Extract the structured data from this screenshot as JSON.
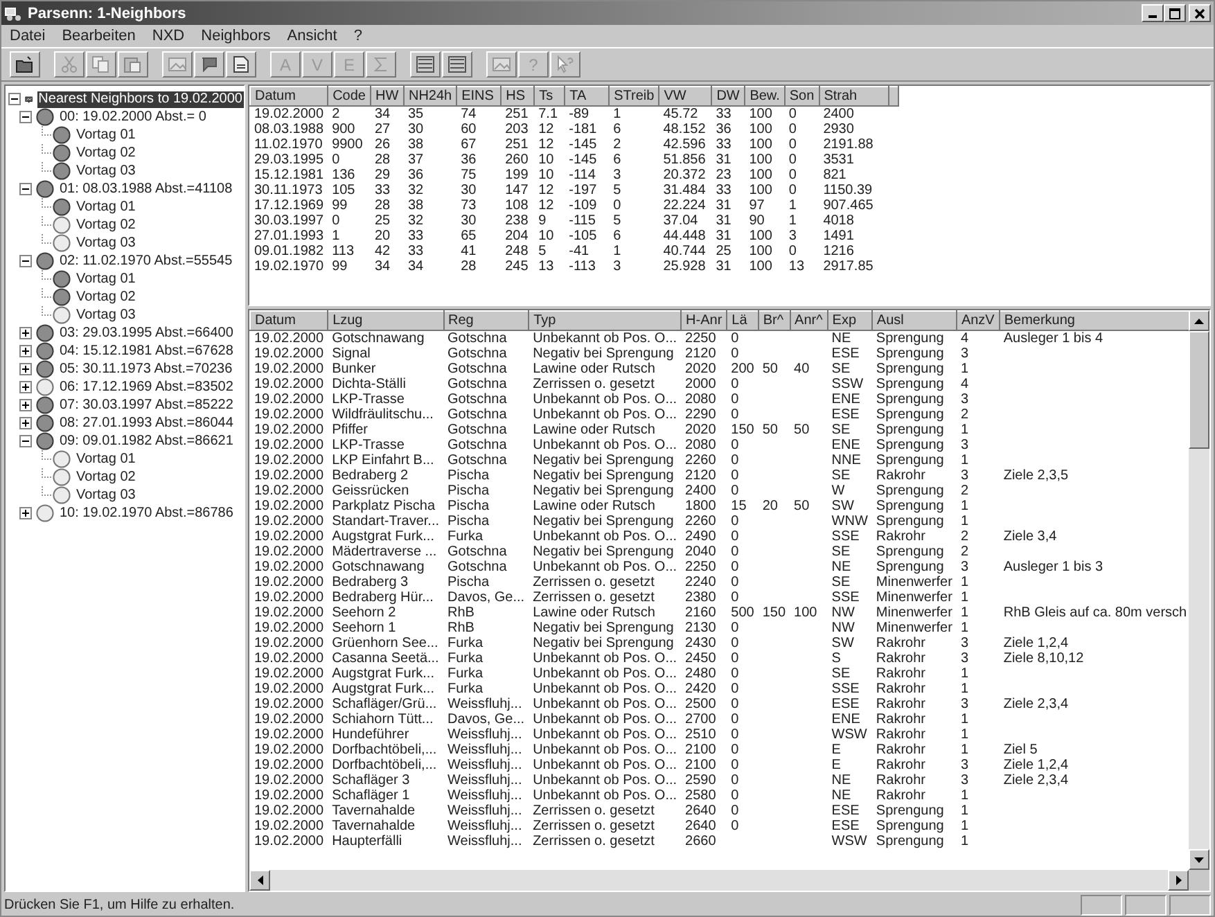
{
  "window": {
    "title": "Parsenn: 1-Neighbors"
  },
  "menu": [
    "Datei",
    "Bearbeiten",
    "NXD",
    "Neighbors",
    "Ansicht",
    "?"
  ],
  "toolbar": [
    {
      "kind": "folder"
    },
    {
      "kind": "sep"
    },
    {
      "kind": "cut"
    },
    {
      "kind": "copy"
    },
    {
      "kind": "paste"
    },
    {
      "kind": "sep"
    },
    {
      "kind": "image"
    },
    {
      "kind": "flag"
    },
    {
      "kind": "page"
    },
    {
      "kind": "sep"
    },
    {
      "kind": "letter",
      "label": "A"
    },
    {
      "kind": "letter",
      "label": "V"
    },
    {
      "kind": "letter",
      "label": "E"
    },
    {
      "kind": "sigma"
    },
    {
      "kind": "sep"
    },
    {
      "kind": "list"
    },
    {
      "kind": "list"
    },
    {
      "kind": "sep"
    },
    {
      "kind": "image"
    },
    {
      "kind": "letter",
      "label": "?"
    },
    {
      "kind": "helpcursor"
    }
  ],
  "tree": {
    "label": "Nearest Neighbors to 19.02.2000",
    "selected": true,
    "expanded": true,
    "children": [
      {
        "label": "00: 19.02.2000 Abst.=  0",
        "filled": true,
        "expanded": true,
        "children": [
          {
            "label": "Vortag 01",
            "filled": true
          },
          {
            "label": "Vortag 02",
            "filled": true
          },
          {
            "label": "Vortag 03",
            "filled": true
          }
        ]
      },
      {
        "label": "01: 08.03.1988 Abst.=41108",
        "filled": true,
        "expanded": true,
        "children": [
          {
            "label": "Vortag 01",
            "filled": true
          },
          {
            "label": "Vortag 02",
            "filled": false
          },
          {
            "label": "Vortag 03",
            "filled": false
          }
        ]
      },
      {
        "label": "02: 11.02.1970 Abst.=55545",
        "filled": true,
        "expanded": true,
        "children": [
          {
            "label": "Vortag 01",
            "filled": true
          },
          {
            "label": "Vortag 02",
            "filled": true
          },
          {
            "label": "Vortag 03",
            "filled": false
          }
        ]
      },
      {
        "label": "03: 29.03.1995 Abst.=66400",
        "filled": true,
        "expanded": false
      },
      {
        "label": "04: 15.12.1981 Abst.=67628",
        "filled": true,
        "expanded": false
      },
      {
        "label": "05: 30.11.1973 Abst.=70236",
        "filled": true,
        "expanded": false
      },
      {
        "label": "06: 17.12.1969 Abst.=83502",
        "filled": false,
        "expanded": false
      },
      {
        "label": "07: 30.03.1997 Abst.=85222",
        "filled": true,
        "expanded": false
      },
      {
        "label": "08: 27.01.1993 Abst.=86044",
        "filled": true,
        "expanded": false
      },
      {
        "label": "09: 09.01.1982 Abst.=86621",
        "filled": true,
        "expanded": true,
        "children": [
          {
            "label": "Vortag 01",
            "filled": false
          },
          {
            "label": "Vortag 02",
            "filled": false
          },
          {
            "label": "Vortag 03",
            "filled": false
          }
        ]
      },
      {
        "label": "10: 19.02.1970 Abst.=86786",
        "filled": false,
        "expanded": false
      }
    ]
  },
  "neighbors_table": {
    "columns": [
      "Datum",
      "Code",
      "HW",
      "NH24h",
      "EINS",
      "HS",
      "Ts",
      "TA",
      "STreib",
      "VW",
      "DW",
      "Bew.",
      "Son",
      "Strah"
    ],
    "rows": [
      [
        "19.02.2000",
        "2",
        "34",
        "35",
        "74",
        "251",
        "7.1",
        "-89",
        "1",
        "45.72",
        "33",
        "100",
        "0",
        "2400"
      ],
      [
        "08.03.1988",
        "900",
        "27",
        "30",
        "60",
        "203",
        "12",
        "-181",
        "6",
        "48.152",
        "36",
        "100",
        "0",
        "2930"
      ],
      [
        "11.02.1970",
        "9900",
        "26",
        "38",
        "67",
        "251",
        "12",
        "-145",
        "2",
        "42.596",
        "33",
        "100",
        "0",
        "2191.88"
      ],
      [
        "29.03.1995",
        "0",
        "28",
        "37",
        "36",
        "260",
        "10",
        "-145",
        "6",
        "51.856",
        "31",
        "100",
        "0",
        "3531"
      ],
      [
        "15.12.1981",
        "136",
        "29",
        "36",
        "75",
        "199",
        "10",
        "-114",
        "3",
        "20.372",
        "23",
        "100",
        "0",
        "821"
      ],
      [
        "30.11.1973",
        "105",
        "33",
        "32",
        "30",
        "147",
        "12",
        "-197",
        "5",
        "31.484",
        "33",
        "100",
        "0",
        "1150.39"
      ],
      [
        "17.12.1969",
        "99",
        "28",
        "38",
        "73",
        "108",
        "12",
        "-109",
        "0",
        "22.224",
        "31",
        "97",
        "1",
        "907.465"
      ],
      [
        "30.03.1997",
        "0",
        "25",
        "32",
        "30",
        "238",
        "9",
        "-115",
        "5",
        "37.04",
        "31",
        "90",
        "1",
        "4018"
      ],
      [
        "27.01.1993",
        "1",
        "20",
        "33",
        "65",
        "204",
        "10",
        "-105",
        "6",
        "44.448",
        "31",
        "100",
        "3",
        "1491"
      ],
      [
        "09.01.1982",
        "113",
        "42",
        "33",
        "41",
        "248",
        "5",
        "-41",
        "1",
        "40.744",
        "25",
        "100",
        "0",
        "1216"
      ],
      [
        "19.02.1970",
        "99",
        "34",
        "34",
        "28",
        "245",
        "13",
        "-113",
        "3",
        "25.928",
        "31",
        "100",
        "13",
        "2917.85"
      ]
    ]
  },
  "events_table": {
    "columns": [
      "Datum",
      "Lzug",
      "Reg",
      "Typ",
      "H-Anr",
      "Lä",
      "Br^",
      "Anr^",
      "Exp",
      "Ausl",
      "AnzV",
      "Bemerkung"
    ],
    "rows": [
      [
        "19.02.2000",
        "Gotschnawang",
        "Gotschna",
        "Unbekannt ob Pos. O...",
        "2250",
        "0",
        "",
        "",
        "NE",
        "Sprengung",
        "4",
        "Ausleger 1 bis 4"
      ],
      [
        "19.02.2000",
        "Signal",
        "Gotschna",
        "Negativ bei Sprengung",
        "2120",
        "0",
        "",
        "",
        "ESE",
        "Sprengung",
        "3",
        ""
      ],
      [
        "19.02.2000",
        "Bunker",
        "Gotschna",
        "Lawine oder Rutsch",
        "2020",
        "200",
        "50",
        "40",
        "SE",
        "Sprengung",
        "1",
        ""
      ],
      [
        "19.02.2000",
        "Dichta-Ställi",
        "Gotschna",
        "Zerrissen o. gesetzt",
        "2000",
        "0",
        "",
        "",
        "SSW",
        "Sprengung",
        "4",
        ""
      ],
      [
        "19.02.2000",
        "LKP-Trasse",
        "Gotschna",
        "Unbekannt ob Pos. O...",
        "2080",
        "0",
        "",
        "",
        "ENE",
        "Sprengung",
        "3",
        ""
      ],
      [
        "19.02.2000",
        "Wildfräulitschu...",
        "Gotschna",
        "Unbekannt ob Pos. O...",
        "2290",
        "0",
        "",
        "",
        "ESE",
        "Sprengung",
        "2",
        ""
      ],
      [
        "19.02.2000",
        "Pfiffer",
        "Gotschna",
        "Lawine oder Rutsch",
        "2020",
        "150",
        "50",
        "50",
        "SE",
        "Sprengung",
        "1",
        ""
      ],
      [
        "19.02.2000",
        "LKP-Trasse",
        "Gotschna",
        "Unbekannt ob Pos. O...",
        "2080",
        "0",
        "",
        "",
        "ENE",
        "Sprengung",
        "3",
        ""
      ],
      [
        "19.02.2000",
        "LKP Einfahrt B...",
        "Gotschna",
        "Negativ bei Sprengung",
        "2260",
        "0",
        "",
        "",
        "NNE",
        "Sprengung",
        "1",
        ""
      ],
      [
        "19.02.2000",
        "Bedraberg 2",
        "Pischa",
        "Negativ bei Sprengung",
        "2120",
        "0",
        "",
        "",
        "SE",
        "Rakrohr",
        "3",
        "Ziele 2,3,5"
      ],
      [
        "19.02.2000",
        "Geissrücken",
        "Pischa",
        "Negativ bei Sprengung",
        "2400",
        "0",
        "",
        "",
        "W",
        "Sprengung",
        "2",
        ""
      ],
      [
        "19.02.2000",
        "Parkplatz Pischa",
        "Pischa",
        "Lawine oder Rutsch",
        "1800",
        "15",
        "20",
        "50",
        "SW",
        "Sprengung",
        "1",
        ""
      ],
      [
        "19.02.2000",
        "Standart-Traver...",
        "Pischa",
        "Negativ bei Sprengung",
        "2260",
        "0",
        "",
        "",
        "WNW",
        "Sprengung",
        "1",
        ""
      ],
      [
        "19.02.2000",
        "Augstgrat Furk...",
        "Furka",
        "Unbekannt ob Pos. O...",
        "2490",
        "0",
        "",
        "",
        "SSE",
        "Rakrohr",
        "2",
        "Ziele 3,4"
      ],
      [
        "19.02.2000",
        "Mädertraverse ...",
        "Gotschna",
        "Negativ bei Sprengung",
        "2040",
        "0",
        "",
        "",
        "SE",
        "Sprengung",
        "2",
        ""
      ],
      [
        "19.02.2000",
        "Gotschnawang",
        "Gotschna",
        "Unbekannt ob Pos. O...",
        "2250",
        "0",
        "",
        "",
        "NE",
        "Sprengung",
        "3",
        "Ausleger 1 bis 3"
      ],
      [
        "19.02.2000",
        "Bedraberg 3",
        "Pischa",
        "Zerrissen o. gesetzt",
        "2240",
        "0",
        "",
        "",
        "SE",
        "Minenwerfer",
        "1",
        ""
      ],
      [
        "19.02.2000",
        "Bedraberg Hür...",
        "Davos, Ge...",
        "Zerrissen o. gesetzt",
        "2380",
        "0",
        "",
        "",
        "SSE",
        "Minenwerfer",
        "1",
        ""
      ],
      [
        "19.02.2000",
        "Seehorn 2",
        "RhB",
        "Lawine oder Rutsch",
        "2160",
        "500",
        "150",
        "100",
        "NW",
        "Minenwerfer",
        "1",
        "RhB Gleis auf ca. 80m versch"
      ],
      [
        "19.02.2000",
        "Seehorn 1",
        "RhB",
        "Negativ bei Sprengung",
        "2130",
        "0",
        "",
        "",
        "NW",
        "Minenwerfer",
        "1",
        ""
      ],
      [
        "19.02.2000",
        "Grüenhorn See...",
        "Furka",
        "Negativ bei Sprengung",
        "2430",
        "0",
        "",
        "",
        "SW",
        "Rakrohr",
        "3",
        "Ziele 1,2,4"
      ],
      [
        "19.02.2000",
        "Casanna Seetä...",
        "Furka",
        "Unbekannt ob Pos. O...",
        "2450",
        "0",
        "",
        "",
        "S",
        "Rakrohr",
        "3",
        "Ziele 8,10,12"
      ],
      [
        "19.02.2000",
        "Augstgrat Furk...",
        "Furka",
        "Unbekannt ob Pos. O...",
        "2480",
        "0",
        "",
        "",
        "SE",
        "Rakrohr",
        "1",
        ""
      ],
      [
        "19.02.2000",
        "Augstgrat Furk...",
        "Furka",
        "Unbekannt ob Pos. O...",
        "2420",
        "0",
        "",
        "",
        "SSE",
        "Rakrohr",
        "1",
        ""
      ],
      [
        "19.02.2000",
        "Schafläger/Grü...",
        "Weissfluhj...",
        "Unbekannt ob Pos. O...",
        "2500",
        "0",
        "",
        "",
        "ESE",
        "Rakrohr",
        "3",
        "Ziele 2,3,4"
      ],
      [
        "19.02.2000",
        "Schiahorn Tütt...",
        "Davos, Ge...",
        "Unbekannt ob Pos. O...",
        "2700",
        "0",
        "",
        "",
        "ENE",
        "Rakrohr",
        "1",
        ""
      ],
      [
        "19.02.2000",
        "Hundeführer",
        "Weissfluhj...",
        "Unbekannt ob Pos. O...",
        "2510",
        "0",
        "",
        "",
        "WSW",
        "Rakrohr",
        "1",
        ""
      ],
      [
        "19.02.2000",
        "Dorfbachtöbeli,...",
        "Weissfluhj...",
        "Unbekannt ob Pos. O...",
        "2100",
        "0",
        "",
        "",
        "E",
        "Rakrohr",
        "1",
        "Ziel 5"
      ],
      [
        "19.02.2000",
        "Dorfbachtöbeli,...",
        "Weissfluhj...",
        "Unbekannt ob Pos. O...",
        "2100",
        "0",
        "",
        "",
        "E",
        "Rakrohr",
        "3",
        "Ziele 1,2,4"
      ],
      [
        "19.02.2000",
        "Schafläger 3",
        "Weissfluhj...",
        "Unbekannt ob Pos. O...",
        "2590",
        "0",
        "",
        "",
        "NE",
        "Rakrohr",
        "3",
        "Ziele 2,3,4"
      ],
      [
        "19.02.2000",
        "Schafläger 1",
        "Weissfluhj...",
        "Unbekannt ob Pos. O...",
        "2580",
        "0",
        "",
        "",
        "NE",
        "Rakrohr",
        "1",
        ""
      ],
      [
        "19.02.2000",
        "Tavernahalde",
        "Weissfluhj...",
        "Zerrissen o. gesetzt",
        "2640",
        "0",
        "",
        "",
        "ESE",
        "Sprengung",
        "1",
        ""
      ],
      [
        "19.02.2000",
        "Tavernahalde",
        "Weissfluhj...",
        "Zerrissen o. gesetzt",
        "2640",
        "0",
        "",
        "",
        "ESE",
        "Sprengung",
        "1",
        ""
      ],
      [
        "19.02.2000",
        "Haupterfälli",
        "Weissfluhj...",
        "Zerrissen o. gesetzt",
        "2660",
        "",
        "",
        "",
        "WSW",
        "Sprengung",
        "1",
        ""
      ]
    ]
  },
  "status_bar": {
    "text": "Drücken Sie F1, um Hilfe zu erhalten."
  }
}
